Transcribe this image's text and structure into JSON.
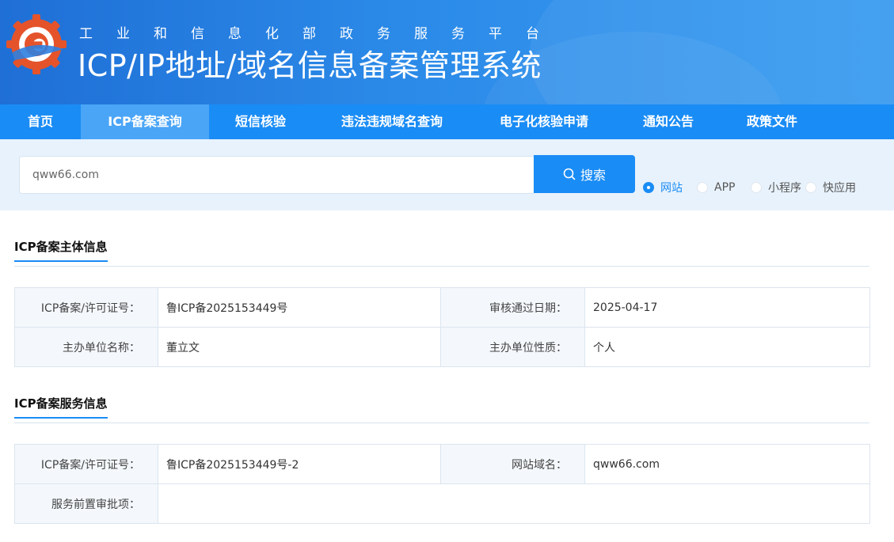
{
  "header": {
    "subtitle": "工业和信息化部政务服务平台",
    "title": "ICP/IP地址/域名信息备案管理系统"
  },
  "nav": {
    "items": [
      {
        "label": "首页"
      },
      {
        "label": "ICP备案查询",
        "active": true
      },
      {
        "label": "短信核验"
      },
      {
        "label": "违法违规域名查询"
      },
      {
        "label": "电子化核验申请"
      },
      {
        "label": "通知公告"
      },
      {
        "label": "政策文件"
      }
    ]
  },
  "search": {
    "value": "qww66.com",
    "button_label": "搜索",
    "types": [
      {
        "label": "网站",
        "checked": true
      },
      {
        "label": "APP",
        "checked": false
      },
      {
        "label": "小程序",
        "checked": false
      },
      {
        "label": "快应用",
        "checked": false
      }
    ]
  },
  "subject_info": {
    "title": "ICP备案主体信息",
    "license_label": "ICP备案/许可证号：",
    "license_value": "鲁ICP备2025153449号",
    "approve_date_label": "审核通过日期：",
    "approve_date_value": "2025-04-17",
    "org_name_label": "主办单位名称：",
    "org_name_value": "董立文",
    "org_type_label": "主办单位性质：",
    "org_type_value": "个人"
  },
  "service_info": {
    "title": "ICP备案服务信息",
    "license_label": "ICP备案/许可证号：",
    "license_value": "鲁ICP备2025153449号-2",
    "domain_label": "网站域名：",
    "domain_value": "qww66.com",
    "preapproval_label": "服务前置审批项：",
    "preapproval_value": ""
  },
  "colors": {
    "primary": "#1a8cf5",
    "header_dark": "#1f6fd6",
    "search_bg": "#e8f2fc",
    "label_bg": "#f4f8fc"
  },
  "icons": [
    "gov-logo-icon",
    "search-icon"
  ]
}
